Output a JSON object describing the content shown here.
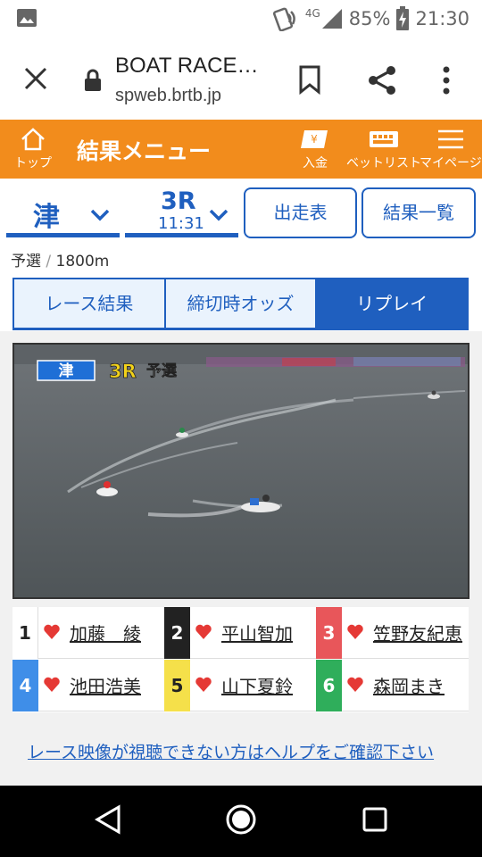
{
  "status_bar": {
    "network": "4G",
    "battery": "85%",
    "time": "21:30"
  },
  "browser": {
    "page_title": "BOAT RACE…",
    "url": "spweb.brtb.jp"
  },
  "header": {
    "home_label": "トップ",
    "menu_title": "結果メニュー",
    "deposit_label": "入金",
    "betlist_label": "ベットリスト",
    "mypage_label": "マイページ"
  },
  "selectors": {
    "venue": "津",
    "race": "3R",
    "race_time": "11:31",
    "entries_button": "出走表",
    "results_list_button": "結果一覧"
  },
  "race_info": {
    "type": "予選",
    "separator": "/",
    "distance": "1800m"
  },
  "tabs": [
    {
      "label": "レース結果",
      "active": false
    },
    {
      "label": "締切時オッズ",
      "active": false
    },
    {
      "label": "リプレイ",
      "active": true
    }
  ],
  "video": {
    "venue_badge": "津",
    "race_badge": "3R",
    "type_badge": "予選"
  },
  "racers": [
    {
      "num": "1",
      "name": "加藤　綾",
      "color": "#ffffff",
      "text_color": "#222222"
    },
    {
      "num": "2",
      "name": "平山智加",
      "color": "#222222",
      "text_color": "#ffffff"
    },
    {
      "num": "3",
      "name": "笠野友紀恵",
      "color": "#e8565a",
      "text_color": "#ffffff"
    },
    {
      "num": "4",
      "name": "池田浩美",
      "color": "#3f8ee8",
      "text_color": "#ffffff"
    },
    {
      "num": "5",
      "name": "山下夏鈴",
      "color": "#f5e04a",
      "text_color": "#222222"
    },
    {
      "num": "6",
      "name": "森岡まき",
      "color": "#2fae5b",
      "text_color": "#ffffff"
    }
  ],
  "help_link": "レース映像が視聴できない方はヘルプをご確認下さい",
  "colors": {
    "accent_blue": "#1f5fbf",
    "header_orange": "#f28c1c",
    "heart_red": "#e53935"
  }
}
